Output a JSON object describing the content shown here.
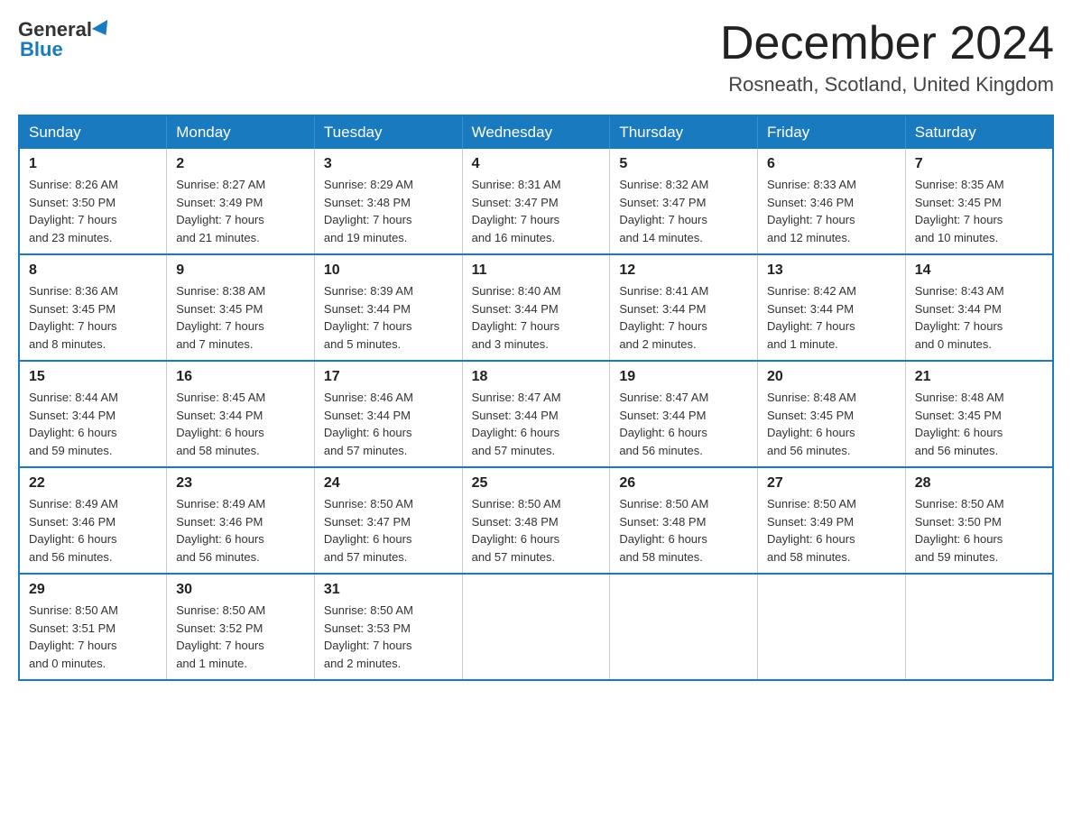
{
  "header": {
    "logo": {
      "general": "General",
      "blue": "Blue"
    },
    "title": "December 2024",
    "location": "Rosneath, Scotland, United Kingdom"
  },
  "weekdays": [
    "Sunday",
    "Monday",
    "Tuesday",
    "Wednesday",
    "Thursday",
    "Friday",
    "Saturday"
  ],
  "weeks": [
    [
      {
        "day": "1",
        "sunrise": "8:26 AM",
        "sunset": "3:50 PM",
        "daylight": "7 hours and 23 minutes."
      },
      {
        "day": "2",
        "sunrise": "8:27 AM",
        "sunset": "3:49 PM",
        "daylight": "7 hours and 21 minutes."
      },
      {
        "day": "3",
        "sunrise": "8:29 AM",
        "sunset": "3:48 PM",
        "daylight": "7 hours and 19 minutes."
      },
      {
        "day": "4",
        "sunrise": "8:31 AM",
        "sunset": "3:47 PM",
        "daylight": "7 hours and 16 minutes."
      },
      {
        "day": "5",
        "sunrise": "8:32 AM",
        "sunset": "3:47 PM",
        "daylight": "7 hours and 14 minutes."
      },
      {
        "day": "6",
        "sunrise": "8:33 AM",
        "sunset": "3:46 PM",
        "daylight": "7 hours and 12 minutes."
      },
      {
        "day": "7",
        "sunrise": "8:35 AM",
        "sunset": "3:45 PM",
        "daylight": "7 hours and 10 minutes."
      }
    ],
    [
      {
        "day": "8",
        "sunrise": "8:36 AM",
        "sunset": "3:45 PM",
        "daylight": "7 hours and 8 minutes."
      },
      {
        "day": "9",
        "sunrise": "8:38 AM",
        "sunset": "3:45 PM",
        "daylight": "7 hours and 7 minutes."
      },
      {
        "day": "10",
        "sunrise": "8:39 AM",
        "sunset": "3:44 PM",
        "daylight": "7 hours and 5 minutes."
      },
      {
        "day": "11",
        "sunrise": "8:40 AM",
        "sunset": "3:44 PM",
        "daylight": "7 hours and 3 minutes."
      },
      {
        "day": "12",
        "sunrise": "8:41 AM",
        "sunset": "3:44 PM",
        "daylight": "7 hours and 2 minutes."
      },
      {
        "day": "13",
        "sunrise": "8:42 AM",
        "sunset": "3:44 PM",
        "daylight": "7 hours and 1 minute."
      },
      {
        "day": "14",
        "sunrise": "8:43 AM",
        "sunset": "3:44 PM",
        "daylight": "7 hours and 0 minutes."
      }
    ],
    [
      {
        "day": "15",
        "sunrise": "8:44 AM",
        "sunset": "3:44 PM",
        "daylight": "6 hours and 59 minutes."
      },
      {
        "day": "16",
        "sunrise": "8:45 AM",
        "sunset": "3:44 PM",
        "daylight": "6 hours and 58 minutes."
      },
      {
        "day": "17",
        "sunrise": "8:46 AM",
        "sunset": "3:44 PM",
        "daylight": "6 hours and 57 minutes."
      },
      {
        "day": "18",
        "sunrise": "8:47 AM",
        "sunset": "3:44 PM",
        "daylight": "6 hours and 57 minutes."
      },
      {
        "day": "19",
        "sunrise": "8:47 AM",
        "sunset": "3:44 PM",
        "daylight": "6 hours and 56 minutes."
      },
      {
        "day": "20",
        "sunrise": "8:48 AM",
        "sunset": "3:45 PM",
        "daylight": "6 hours and 56 minutes."
      },
      {
        "day": "21",
        "sunrise": "8:48 AM",
        "sunset": "3:45 PM",
        "daylight": "6 hours and 56 minutes."
      }
    ],
    [
      {
        "day": "22",
        "sunrise": "8:49 AM",
        "sunset": "3:46 PM",
        "daylight": "6 hours and 56 minutes."
      },
      {
        "day": "23",
        "sunrise": "8:49 AM",
        "sunset": "3:46 PM",
        "daylight": "6 hours and 56 minutes."
      },
      {
        "day": "24",
        "sunrise": "8:50 AM",
        "sunset": "3:47 PM",
        "daylight": "6 hours and 57 minutes."
      },
      {
        "day": "25",
        "sunrise": "8:50 AM",
        "sunset": "3:48 PM",
        "daylight": "6 hours and 57 minutes."
      },
      {
        "day": "26",
        "sunrise": "8:50 AM",
        "sunset": "3:48 PM",
        "daylight": "6 hours and 58 minutes."
      },
      {
        "day": "27",
        "sunrise": "8:50 AM",
        "sunset": "3:49 PM",
        "daylight": "6 hours and 58 minutes."
      },
      {
        "day": "28",
        "sunrise": "8:50 AM",
        "sunset": "3:50 PM",
        "daylight": "6 hours and 59 minutes."
      }
    ],
    [
      {
        "day": "29",
        "sunrise": "8:50 AM",
        "sunset": "3:51 PM",
        "daylight": "7 hours and 0 minutes."
      },
      {
        "day": "30",
        "sunrise": "8:50 AM",
        "sunset": "3:52 PM",
        "daylight": "7 hours and 1 minute."
      },
      {
        "day": "31",
        "sunrise": "8:50 AM",
        "sunset": "3:53 PM",
        "daylight": "7 hours and 2 minutes."
      },
      null,
      null,
      null,
      null
    ]
  ],
  "labels": {
    "sunrise": "Sunrise:",
    "sunset": "Sunset:",
    "daylight": "Daylight:"
  }
}
